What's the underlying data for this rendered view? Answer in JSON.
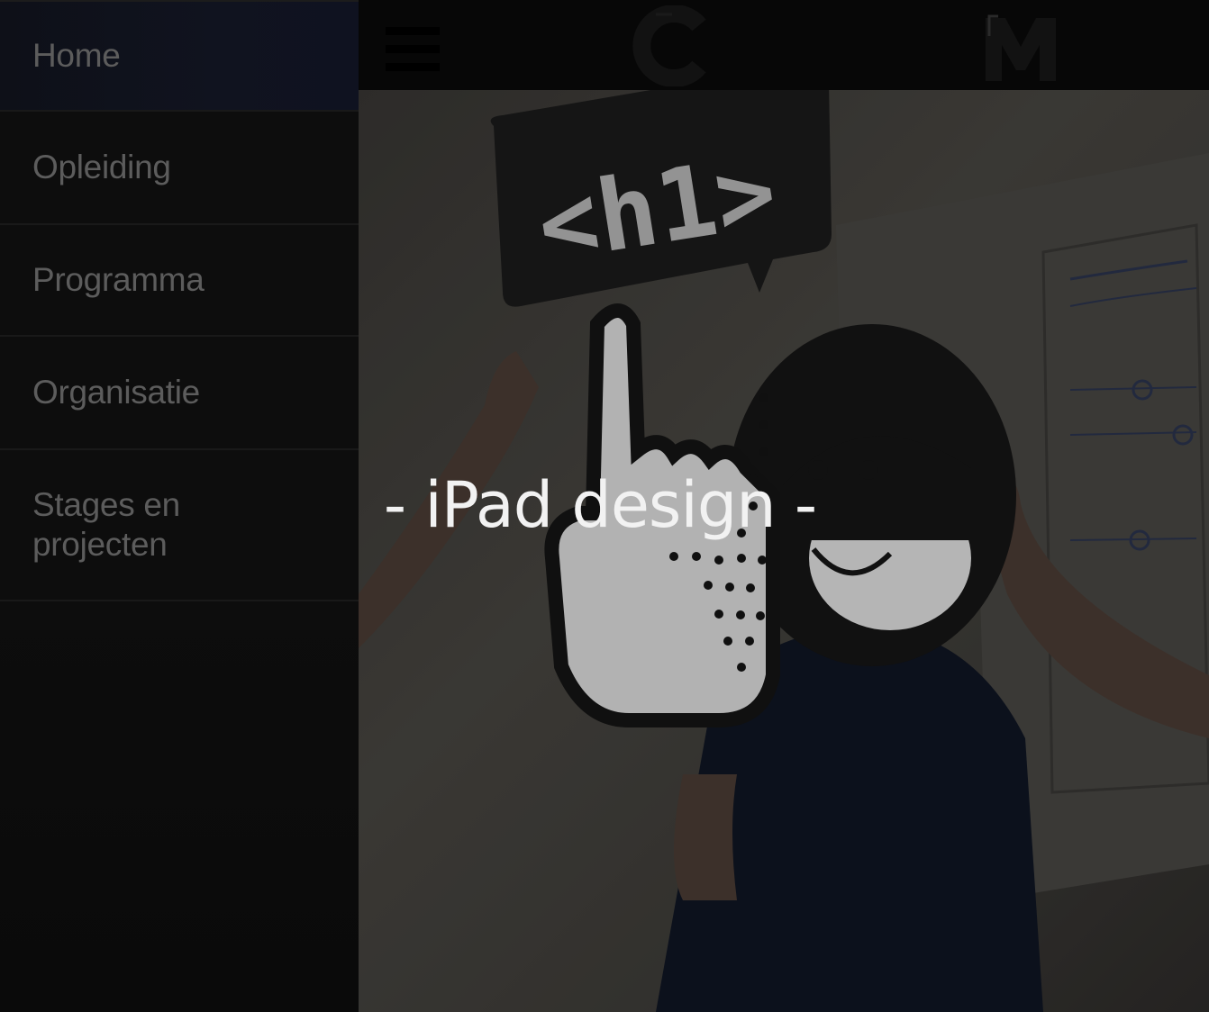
{
  "sidebar": {
    "items": [
      {
        "label": "Home",
        "active": true
      },
      {
        "label": "Opleiding",
        "active": false
      },
      {
        "label": "Programma",
        "active": false
      },
      {
        "label": "Organisatie",
        "active": false
      },
      {
        "label": "Stages en projecten",
        "active": false
      }
    ]
  },
  "topbar": {
    "menu_icon": "hamburger-icon",
    "logo_left": "c-logo-icon",
    "logo_right": "m-logo-icon"
  },
  "hero": {
    "title": "- iPad design -",
    "sign_text": "<h1>"
  },
  "colors": {
    "sidebar_bg": "#0b0b0b",
    "nav_text": "#5c5c5c",
    "active_bg": "#10131f",
    "hero_title": "#f2f2f2"
  }
}
